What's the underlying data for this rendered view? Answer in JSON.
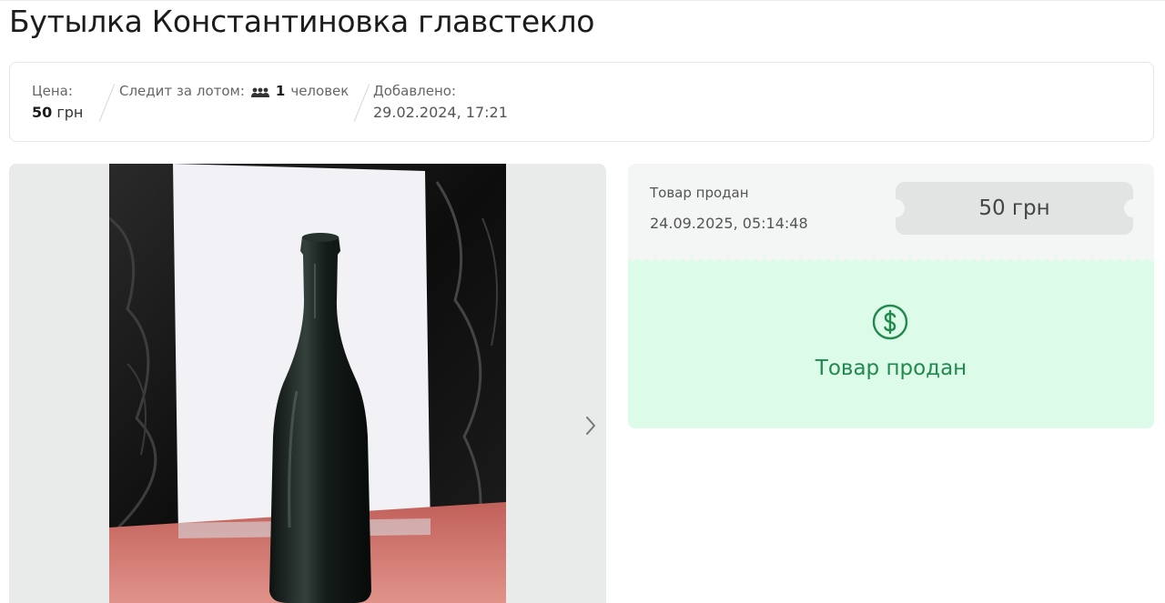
{
  "lot": {
    "title": "Бутылка Константиновка главстекло"
  },
  "info": {
    "price_label": "Цена:",
    "price_value": "50",
    "price_currency": "грн",
    "watch_label": "Следит за лотом:",
    "watch_count": "1",
    "watch_unit": "человек",
    "added_label": "Добавлено:",
    "added_value": "29.02.2024, 17:21"
  },
  "gallery": {
    "next_icon": "chevron-right-icon"
  },
  "sale": {
    "status_label": "Товар продан",
    "sold_at": "24.09.2025, 05:14:48",
    "final_price": "50 грн",
    "status_message": "Товар продан",
    "status_icon": "dollar-circle-icon"
  },
  "colors": {
    "accent_green": "#21894e",
    "sold_bg": "#dcfbe8"
  }
}
